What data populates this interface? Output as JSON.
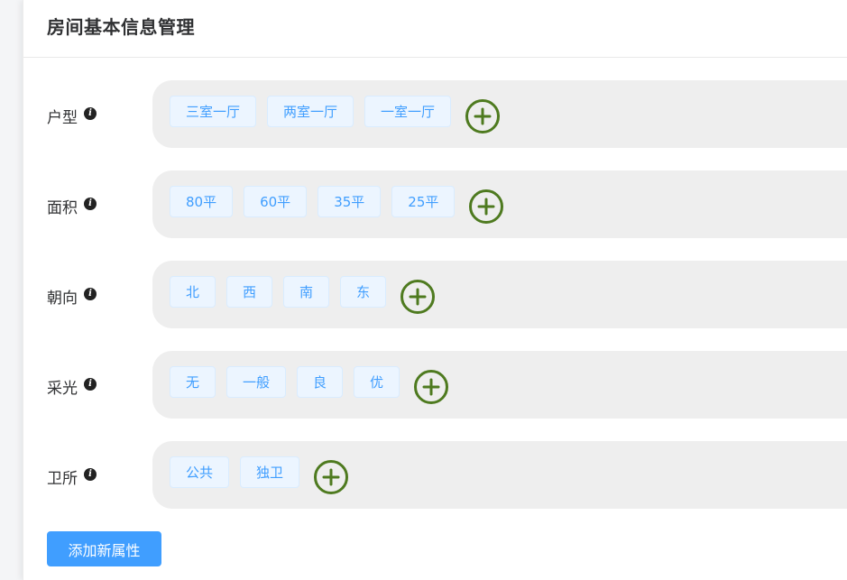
{
  "header": {
    "title": "房间基本信息管理"
  },
  "attributes": [
    {
      "label": "户型",
      "tags": [
        "三室一厅",
        "两室一厅",
        "一室一厅"
      ]
    },
    {
      "label": "面积",
      "tags": [
        "80平",
        "60平",
        "35平",
        "25平"
      ]
    },
    {
      "label": "朝向",
      "tags": [
        "北",
        "西",
        "南",
        "东"
      ]
    },
    {
      "label": "采光",
      "tags": [
        "无",
        "一般",
        "良",
        "优"
      ]
    },
    {
      "label": "卫所",
      "tags": [
        "公共",
        "独卫"
      ]
    }
  ],
  "footer": {
    "add_attribute_label": "添加新属性"
  },
  "colors": {
    "accent": "#409eff",
    "add_icon": "#4e7a1f",
    "tag_bg": "#ecf5ff"
  },
  "icons": {
    "info": "info-icon",
    "add": "plus-circle-icon"
  }
}
